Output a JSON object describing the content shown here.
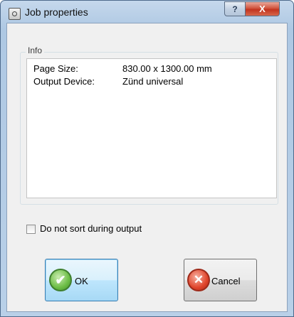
{
  "window": {
    "title": "Job properties",
    "help_label": "?",
    "close_label": "X"
  },
  "info": {
    "group_label": "Info",
    "rows": [
      {
        "label": "Page Size:",
        "value": "830.00 x 1300.00 mm"
      },
      {
        "label": "Output Device:",
        "value": "Zünd universal"
      }
    ]
  },
  "options": {
    "no_sort_label": "Do not sort during output",
    "no_sort_checked": false
  },
  "buttons": {
    "ok_label": "OK",
    "ok_icon": "check-circle-icon",
    "cancel_label": "Cancel",
    "cancel_icon": "x-circle-icon"
  }
}
